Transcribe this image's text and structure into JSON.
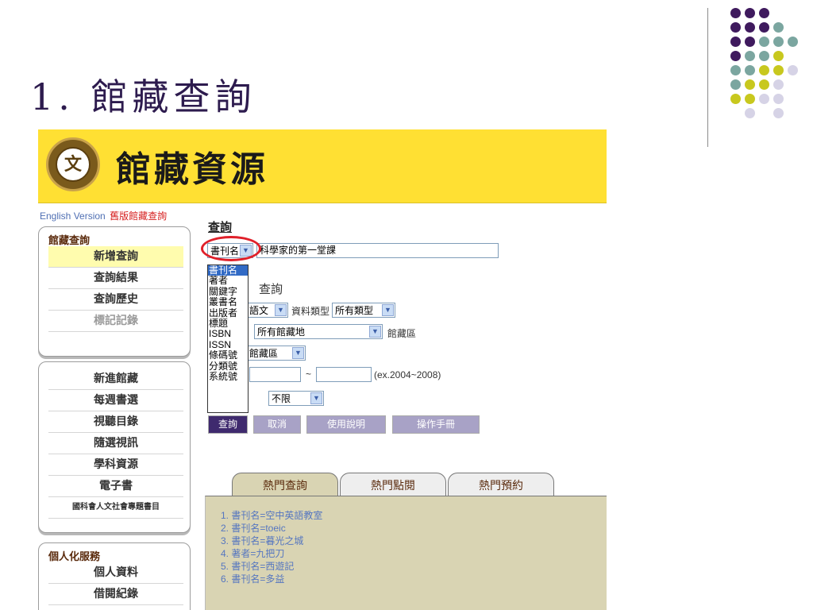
{
  "slide": {
    "title": "1. 館藏查詢"
  },
  "dots": [
    [
      "#3f1a5e",
      "#3f1a5e",
      "#3f1a5e",
      null,
      null
    ],
    [
      "#3f1a5e",
      "#3f1a5e",
      "#3f1a5e",
      "#7ba6a0",
      null
    ],
    [
      "#3f1a5e",
      "#3f1a5e",
      "#7ba6a0",
      "#7ba6a0",
      "#7ba6a0"
    ],
    [
      "#3f1a5e",
      "#7ba6a0",
      "#7ba6a0",
      "#c8c81e",
      null
    ],
    [
      "#7ba6a0",
      "#7ba6a0",
      "#c8c81e",
      "#c8c81e",
      "#d6d3e6"
    ],
    [
      "#7ba6a0",
      "#c8c81e",
      "#c8c81e",
      "#d6d3e6",
      null
    ],
    [
      "#c8c81e",
      "#c8c81e",
      "#d6d3e6",
      "#d6d3e6",
      null
    ],
    [
      null,
      "#d6d3e6",
      null,
      "#d6d3e6",
      null
    ]
  ],
  "banner": {
    "logo_char": "文",
    "title": "館藏資源"
  },
  "top_links": {
    "english": "English Version",
    "old": "舊版館藏查詢"
  },
  "menu1": {
    "header": "館藏查詢",
    "items": [
      "新增查詢",
      "查詢結果",
      "查詢歷史",
      "標記記錄"
    ]
  },
  "menu2": {
    "items": [
      "新進館藏",
      "每週書選",
      "視聽目錄",
      "隨選視訊",
      "學科資源",
      "電子書",
      "國科會人文社會專題書目"
    ]
  },
  "menu3": {
    "header": "個人化服務",
    "items": [
      "個人資料",
      "借閱紀錄"
    ]
  },
  "query": {
    "title": "查詢",
    "field_selected": "書刊名",
    "search_value": "科學家的第一堂課",
    "field_options": [
      "書刊名",
      "著者",
      "關鍵字",
      "叢書名",
      "出版者",
      "標題",
      "ISBN",
      "ISSN",
      "條碼號",
      "分類號",
      "系統號"
    ],
    "row_partial_label": "查詢",
    "language_value": "語文",
    "type_label": "資料類型",
    "type_value": "所有類型",
    "location_value": "所有館藏地",
    "location_label": "館藏區",
    "area_value": "館藏區",
    "year_sep": "~",
    "year_hint": "(ex.2004~2008)",
    "limit_value": "不限"
  },
  "buttons": {
    "search": "查詢",
    "cancel": "取消",
    "help": "使用說明",
    "manual": "操作手冊",
    "search_bg": "#3f2a6e",
    "other_bg": "#a8a2c6"
  },
  "tabs": {
    "hot_search": "熱門查詢",
    "hot_view": "熱門點閱",
    "hot_reserve": "熱門預約"
  },
  "hot_list": [
    "1. 書刊名=空中英語教室",
    "2. 書刊名=toeic",
    "3. 書刊名=暮光之城",
    "4. 著者=九把刀",
    "5. 書刊名=西遊記",
    "6. 書刊名=多益"
  ]
}
